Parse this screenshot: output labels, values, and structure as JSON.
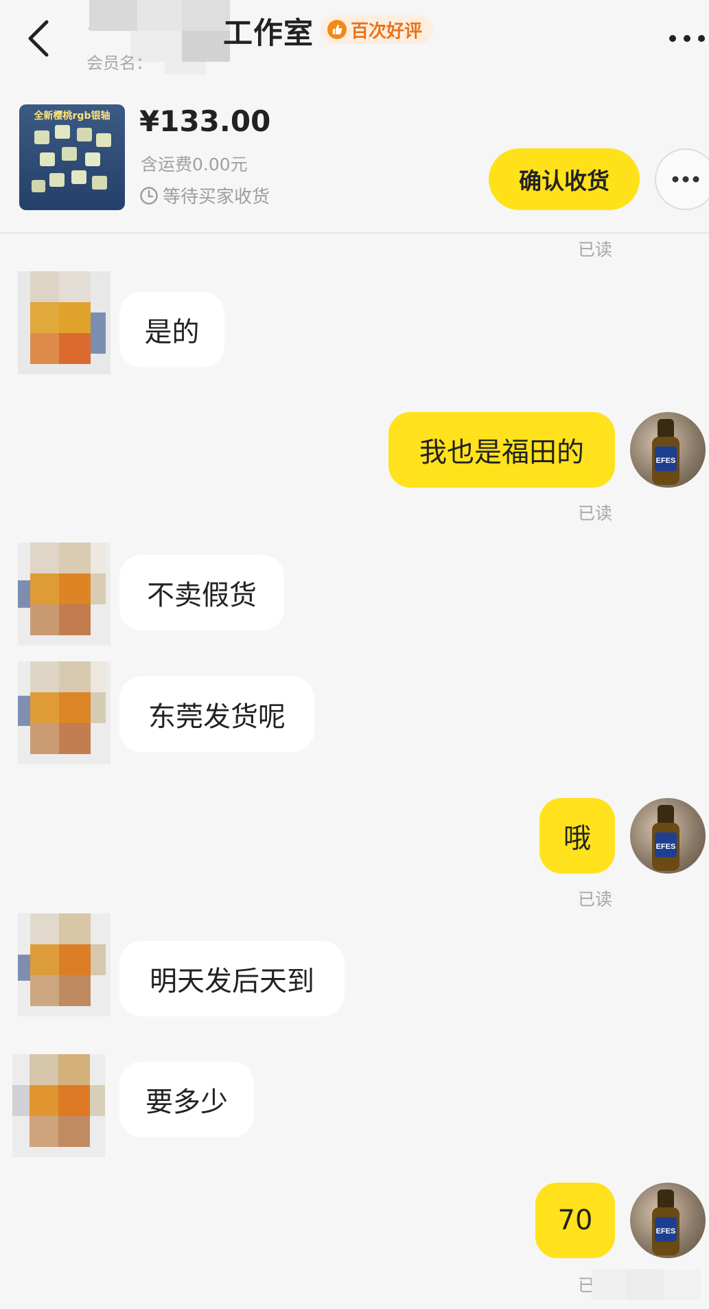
{
  "header": {
    "title_prefix": "-",
    "title": "工作室",
    "badge_label": "百次好评",
    "member_label": "会员名："
  },
  "product": {
    "image_caption": "全新樱桃rgb银轴",
    "price": "¥133.00",
    "shipping": "含运费0.00元",
    "status": "等待买家收货",
    "confirm_label": "确认收货"
  },
  "chat": {
    "read_label": "已读",
    "messages": [
      {
        "text": "是的"
      },
      {
        "text": "我也是福田的"
      },
      {
        "text": "不卖假货"
      },
      {
        "text": "东莞发货呢"
      },
      {
        "text": "哦"
      },
      {
        "text": "明天发后天到"
      },
      {
        "text": "要多少"
      },
      {
        "text": "70"
      }
    ],
    "partial_read_label": "已"
  },
  "colors": {
    "accent_yellow": "#ffe21b",
    "badge_orange": "#f28a18",
    "background": "#f6f6f6"
  }
}
